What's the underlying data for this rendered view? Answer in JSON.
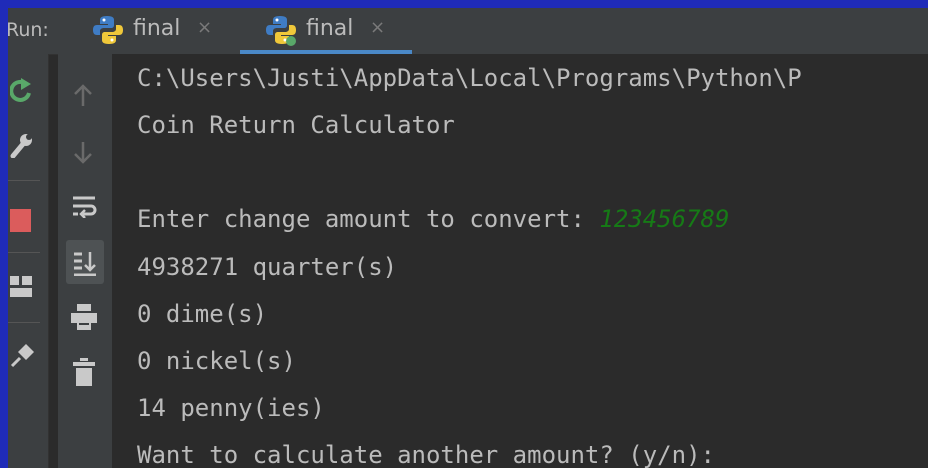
{
  "run_panel": {
    "label": "Run:",
    "tabs": [
      {
        "label": "final",
        "close": "×",
        "active": false
      },
      {
        "label": "final",
        "close": "×",
        "active": true
      }
    ]
  },
  "console": {
    "lines": [
      "C:\\Users\\Justi\\AppData\\Local\\Programs\\Python\\P",
      "Coin Return Calculator",
      "",
      "Enter change amount to convert: ",
      "4938271 quarter(s)",
      "0 dime(s)",
      "0 nickel(s)",
      "14 penny(ies)",
      "Want to calculate another amount? (y/n):"
    ],
    "user_input": "123456789"
  },
  "colors": {
    "background": "#2b2b2b",
    "panel": "#3c3f41",
    "text": "#bbbbbb",
    "user_input": "#167a16",
    "tab_active_underline": "#4a88c7",
    "outer_border": "#1f2bb8"
  },
  "icons": {
    "tab": "python-icon",
    "left_toolbar": [
      "rerun-icon",
      "wrench-icon",
      "stop-icon",
      "layout-icon",
      "pin-icon"
    ],
    "gutter_toolbar": [
      "up-arrow-icon",
      "down-arrow-icon",
      "soft-wrap-icon",
      "scroll-to-end-icon",
      "print-icon",
      "trash-icon"
    ]
  }
}
